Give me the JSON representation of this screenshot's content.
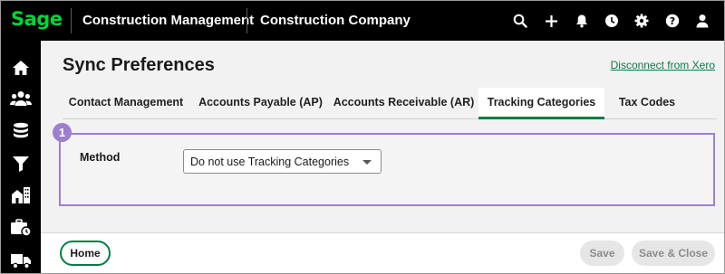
{
  "header": {
    "logo": "Sage",
    "app_name": "Construction Management",
    "company_name": "Construction Company",
    "icons": [
      "search-icon",
      "plus-icon",
      "bell-icon",
      "clock-icon",
      "gear-icon",
      "help-icon",
      "user-icon"
    ]
  },
  "sidebar": {
    "icons": [
      "home-icon",
      "people-icon",
      "database-icon",
      "filter-icon",
      "buildings-icon",
      "briefcase-clock-icon",
      "truck-icon"
    ]
  },
  "page": {
    "title": "Sync Preferences",
    "disconnect_link": "Disconnect from Xero"
  },
  "tabs": [
    {
      "label": "Contact Management",
      "active": false
    },
    {
      "label": "Accounts Payable (AP)",
      "active": false
    },
    {
      "label": "Accounts Receivable (AR)",
      "active": false
    },
    {
      "label": "Tracking Categories",
      "active": true
    },
    {
      "label": "Tax Codes",
      "active": false
    }
  ],
  "form": {
    "callout_number": "1",
    "method_label": "Method",
    "method_value": "Do not use Tracking Categories"
  },
  "footer": {
    "home_label": "Home",
    "save_label": "Save",
    "save_close_label": "Save & Close"
  },
  "colors": {
    "brand_green": "#00d639",
    "accent_green": "#007e45",
    "highlight_purple": "#9d7fd0",
    "topbar_bg": "#000000"
  }
}
